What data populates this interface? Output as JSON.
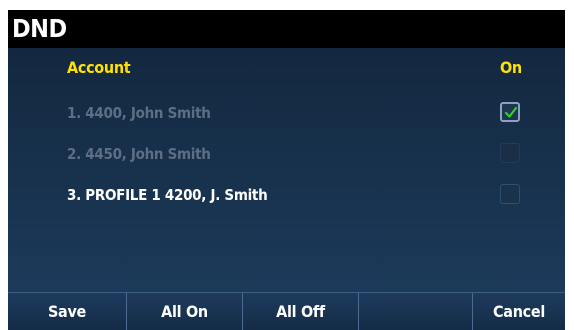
{
  "title": "DND",
  "headers": {
    "account": "Account",
    "on": "On"
  },
  "rows": [
    {
      "label": "1. 4400, John Smith",
      "checked": true,
      "enabled": false
    },
    {
      "label": "2. 4450, John Smith",
      "checked": false,
      "enabled": false
    },
    {
      "label": "3. PROFILE 1 4200, J. Smith",
      "checked": false,
      "enabled": true
    }
  ],
  "softkeys": [
    "Save",
    "All On",
    "All Off",
    "",
    "Cancel"
  ],
  "colors": {
    "header_text": "#ffe100",
    "dim_text": "#5d6f84",
    "check_mark": "#2fd02f"
  }
}
